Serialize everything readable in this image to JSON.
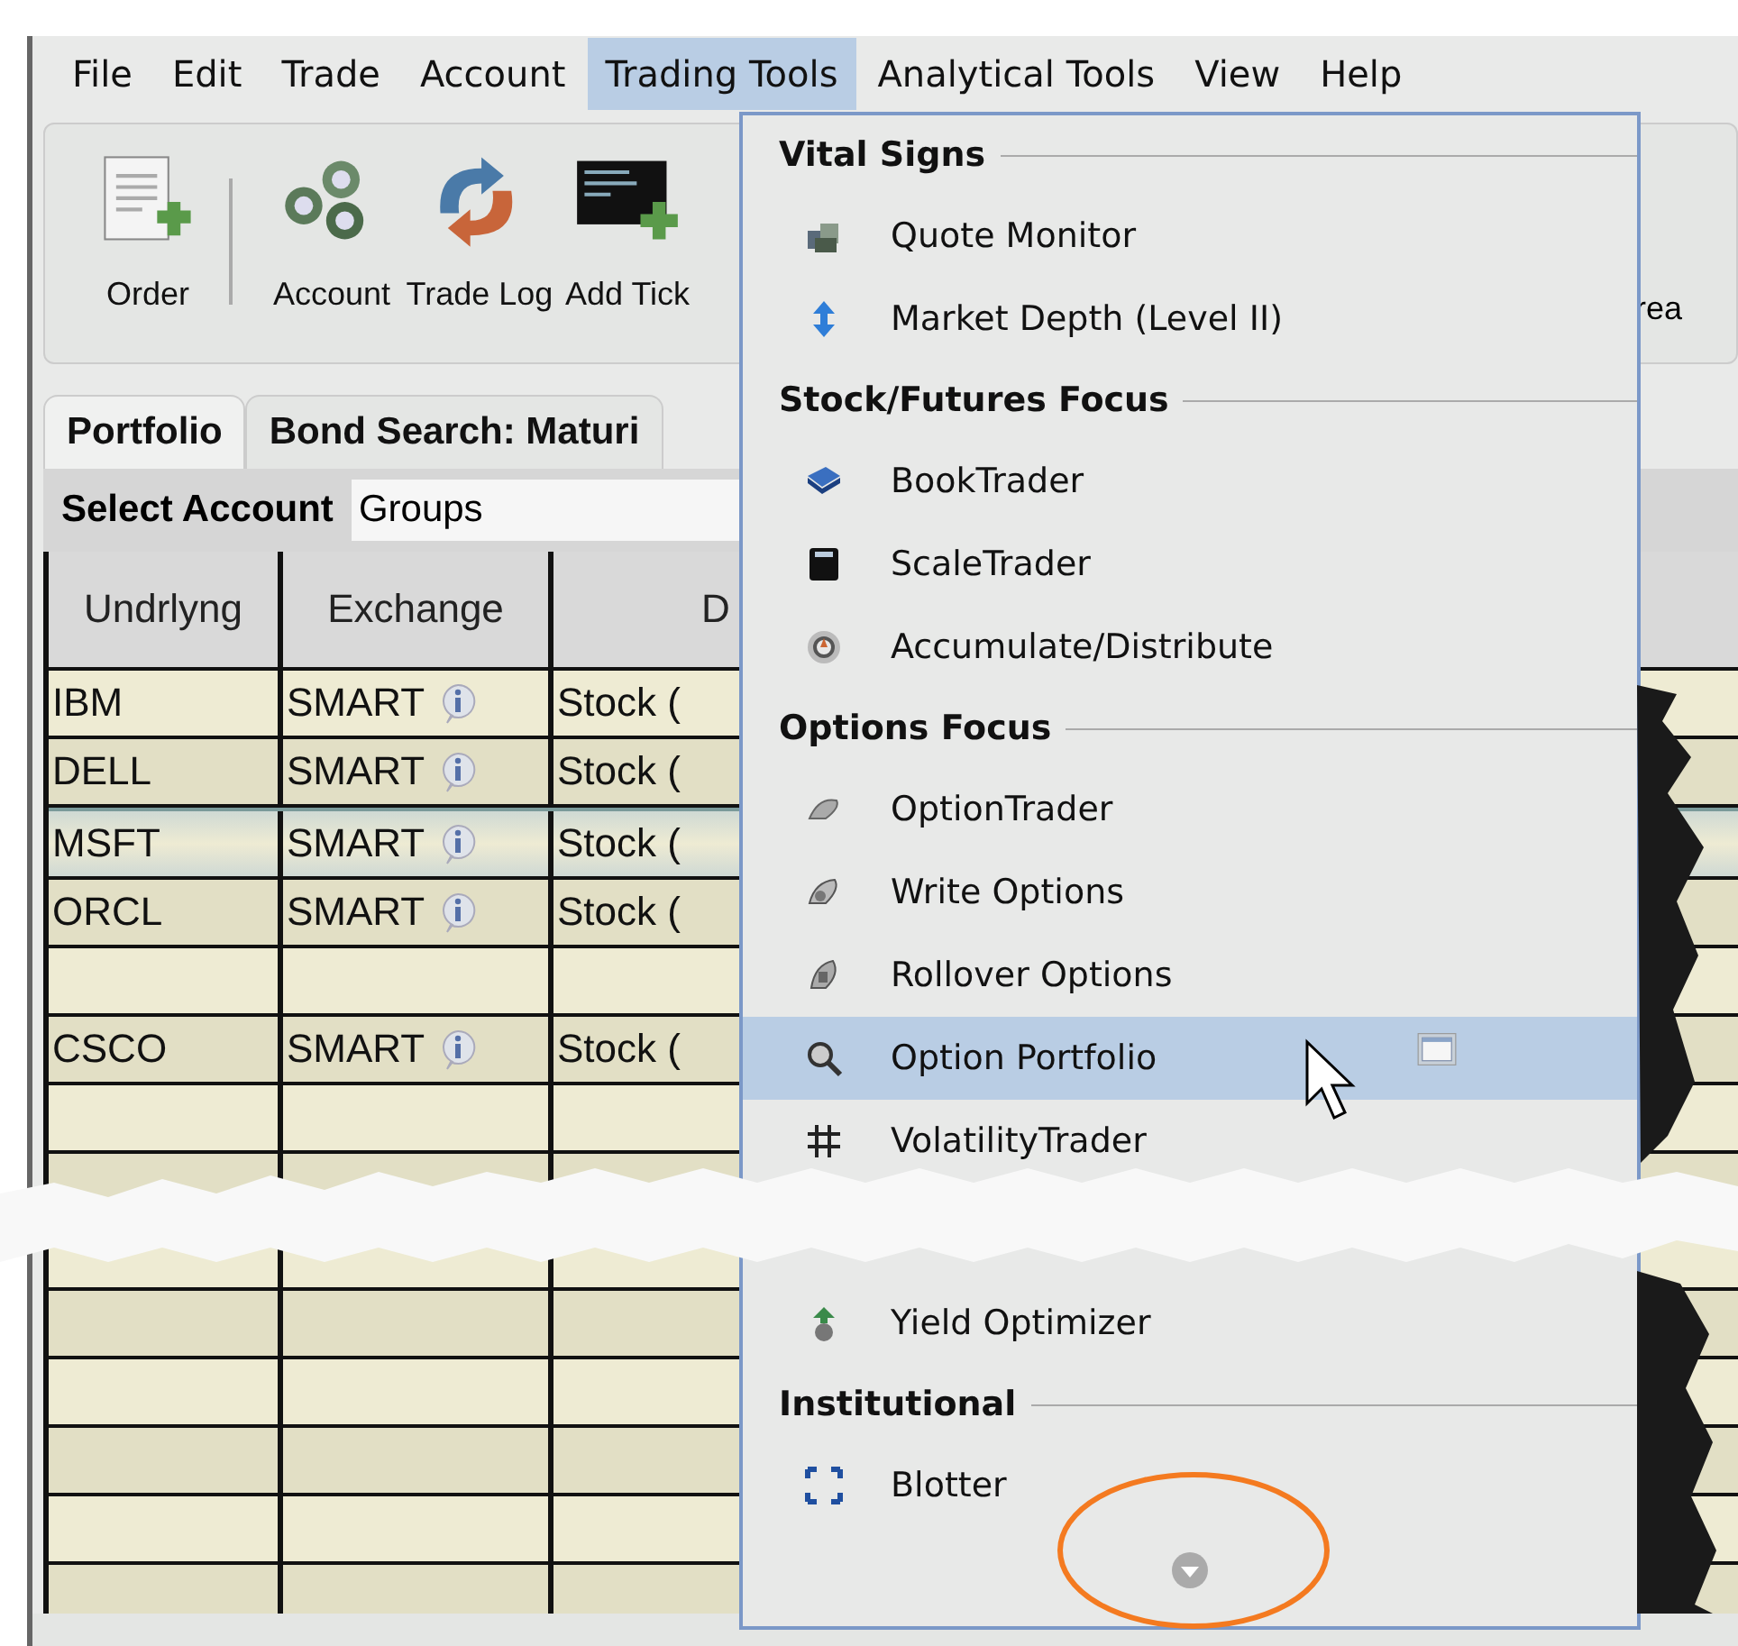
{
  "menubar": [
    {
      "label": "File",
      "selected": false
    },
    {
      "label": "Edit",
      "selected": false
    },
    {
      "label": "Trade",
      "selected": false
    },
    {
      "label": "Account",
      "selected": false
    },
    {
      "label": "Trading Tools",
      "selected": true
    },
    {
      "label": "Analytical Tools",
      "selected": false
    },
    {
      "label": "View",
      "selected": false
    },
    {
      "label": "Help",
      "selected": false
    }
  ],
  "toolbar": [
    {
      "label": "Order"
    },
    {
      "label": "Account"
    },
    {
      "label": "Trade Log"
    },
    {
      "label": "Add Tick"
    }
  ],
  "toolbar_end_label": "rea",
  "tabs": [
    {
      "label": "Portfolio",
      "selected": true
    },
    {
      "label": "Bond Search: Maturi",
      "selected": false
    }
  ],
  "account": {
    "label": "Select Account",
    "value": "Groups"
  },
  "table": {
    "columns": [
      "Undrlyng",
      "Exchange",
      "D"
    ],
    "rows": [
      {
        "undrlyng": "IBM",
        "exchange": "SMART",
        "description": "Stock (",
        "selected": false
      },
      {
        "undrlyng": "DELL",
        "exchange": "SMART",
        "description": "Stock (",
        "selected": false
      },
      {
        "undrlyng": "MSFT",
        "exchange": "SMART",
        "description": "Stock (",
        "selected": true
      },
      {
        "undrlyng": "ORCL",
        "exchange": "SMART",
        "description": "Stock (",
        "selected": false
      },
      {
        "selected": false
      },
      {
        "undrlyng": "CSCO",
        "exchange": "SMART",
        "description": "Stock (",
        "selected": false
      }
    ]
  },
  "menu": {
    "items": [
      {
        "kind": "header",
        "label": "Vital Signs"
      },
      {
        "kind": "item",
        "label": "Quote Monitor",
        "selected": false
      },
      {
        "kind": "item",
        "label": "Market Depth (Level II)",
        "selected": false
      },
      {
        "kind": "header",
        "label": "Stock/Futures Focus"
      },
      {
        "kind": "item",
        "label": "BookTrader",
        "selected": false
      },
      {
        "kind": "item",
        "label": "ScaleTrader",
        "selected": false
      },
      {
        "kind": "item",
        "label": "Accumulate/Distribute",
        "selected": false
      },
      {
        "kind": "header",
        "label": "Options Focus"
      },
      {
        "kind": "item",
        "label": "OptionTrader",
        "selected": false
      },
      {
        "kind": "item",
        "label": "Write Options",
        "selected": false
      },
      {
        "kind": "item",
        "label": "Rollover Options",
        "selected": false
      },
      {
        "kind": "item",
        "label": "Option Portfolio",
        "selected": true
      },
      {
        "kind": "item",
        "label": "VolatilityTrader",
        "selected": false
      },
      {
        "kind": "tear"
      },
      {
        "kind": "item",
        "label": "Yield Optimizer",
        "selected": false
      },
      {
        "kind": "header",
        "label": "Institutional"
      },
      {
        "kind": "item",
        "label": "Blotter",
        "selected": false
      }
    ]
  }
}
